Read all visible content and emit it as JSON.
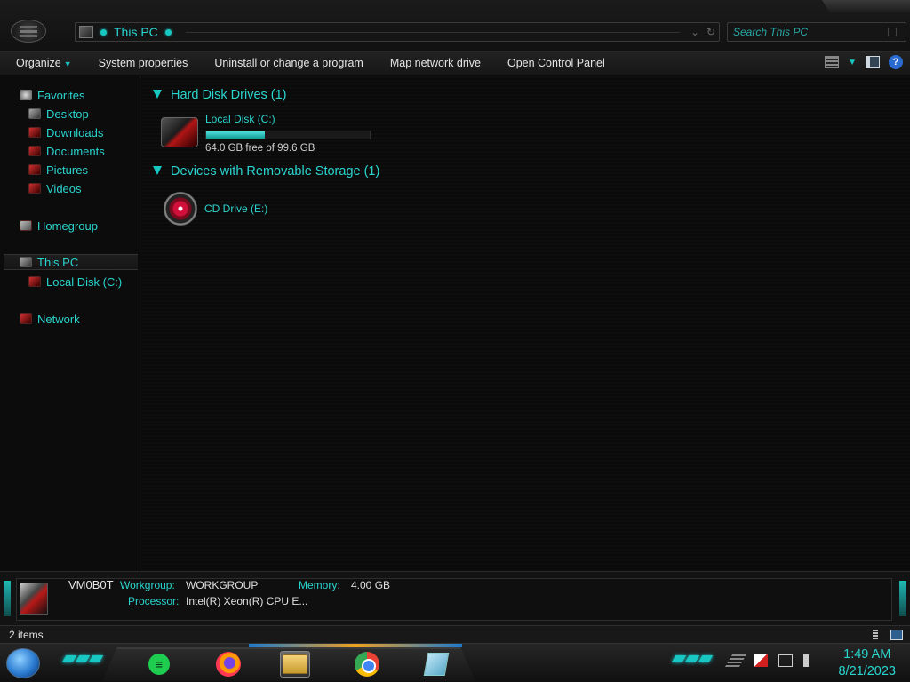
{
  "window": {
    "address": {
      "crumb": "This PC"
    },
    "search": {
      "placeholder": "Search This PC"
    }
  },
  "toolbar": {
    "organize": "Organize",
    "system_properties": "System properties",
    "uninstall": "Uninstall or change a program",
    "map_drive": "Map network drive",
    "control_panel": "Open Control Panel"
  },
  "sidebar": {
    "favorites": "Favorites",
    "desktop": "Desktop",
    "downloads": "Downloads",
    "documents": "Documents",
    "pictures": "Pictures",
    "videos": "Videos",
    "homegroup": "Homegroup",
    "this_pc": "This PC",
    "local_disk": "Local Disk (C:)",
    "network": "Network"
  },
  "content": {
    "hdd_group": "Hard Disk Drives (1)",
    "removable_group": "Devices with Removable Storage (1)",
    "drive_c": {
      "name": "Local Disk (C:)",
      "free": "64.0 GB free of 99.6 GB",
      "used_fraction": 0.357
    },
    "drive_e": {
      "name": "CD Drive (E:)"
    }
  },
  "details": {
    "computer_name": "VM0B0T",
    "workgroup_label": "Workgroup:",
    "workgroup_value": "WORKGROUP",
    "memory_label": "Memory:",
    "memory_value": "4.00 GB",
    "processor_label": "Processor:",
    "processor_value": "Intel(R) Xeon(R) CPU E..."
  },
  "status": {
    "item_count": "2 items"
  },
  "taskbar": {
    "apps": [
      "sheets",
      "firefox",
      "file-explorer",
      "chrome",
      "notes"
    ],
    "time": "1:49 AM",
    "date": "8/21/2023"
  },
  "colors": {
    "accent": "#2ad5cf",
    "background": "#0c0c0c",
    "drive_fill": "#19c7c2"
  }
}
